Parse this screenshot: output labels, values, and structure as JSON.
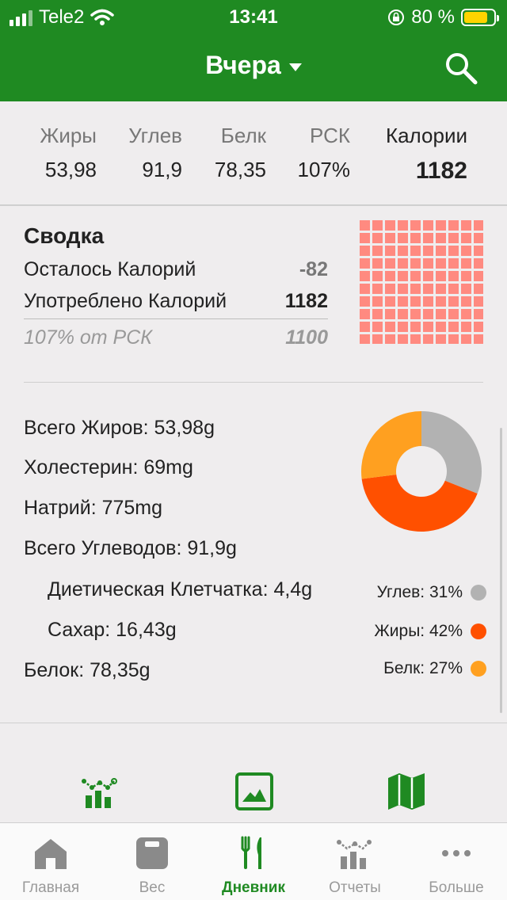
{
  "status": {
    "carrier": "Tele2",
    "time": "13:41",
    "battery": "80 %"
  },
  "nav": {
    "title": "Вчера"
  },
  "macros": {
    "headers": [
      "Жиры",
      "Углев",
      "Белк",
      "РСК",
      "Калории"
    ],
    "values": [
      "53,98",
      "91,9",
      "78,35",
      "107%",
      "1182"
    ]
  },
  "summary": {
    "title": "Сводка",
    "remaining_label": "Осталось Калорий",
    "remaining_value": "-82",
    "consumed_label": "Употреблено Калорий",
    "consumed_value": "1182",
    "rsk_label": "107% от РСК",
    "rsk_value": "1100"
  },
  "nutrients": {
    "total_fat": "Всего Жиров: 53,98g",
    "cholesterol": "Холестерин: 69mg",
    "sodium": "Натрий: 775mg",
    "total_carbs": "Всего Углеводов: 91,9g",
    "fiber": "Диетическая Клетчатка: 4,4g",
    "sugar": "Сахар: 16,43g",
    "protein": "Белок: 78,35g"
  },
  "legend": {
    "carbs": "Углев: 31%",
    "fat": "Жиры: 42%",
    "protein": "Белк: 27%"
  },
  "chart_data": {
    "type": "pie",
    "categories": [
      "Углев",
      "Жиры",
      "Белк"
    ],
    "values": [
      31,
      42,
      27
    ],
    "colors": [
      "#b2b2b2",
      "#ff5000",
      "#ffa020"
    ]
  },
  "tabs": [
    {
      "label": "Главная"
    },
    {
      "label": "Вес"
    },
    {
      "label": "Дневник"
    },
    {
      "label": "Отчеты"
    },
    {
      "label": "Больше"
    }
  ],
  "colors": {
    "brand": "#1f8a22",
    "grid": "#ff8a80"
  }
}
